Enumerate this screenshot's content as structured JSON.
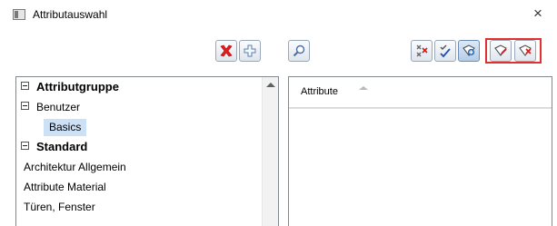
{
  "window": {
    "title": "Attributauswahl",
    "close_glyph": "×"
  },
  "toolbar": {
    "buttons": [
      {
        "name": "delete-button",
        "icon": "red-x-icon"
      },
      {
        "name": "add-button",
        "icon": "plus-icon"
      },
      {
        "name": "search-button",
        "icon": "magnifier-icon"
      },
      {
        "name": "uncheck-all-button",
        "icon": "double-x-icon"
      },
      {
        "name": "check-all-button",
        "icon": "double-check-icon"
      },
      {
        "name": "add-favorite-button",
        "icon": "pin-add-icon",
        "active": true
      },
      {
        "name": "favorite-edit-button",
        "icon": "pin-edit-icon"
      },
      {
        "name": "favorite-remove-button",
        "icon": "pin-remove-icon"
      }
    ],
    "highlight_color": "#e03030"
  },
  "tree": {
    "items": [
      {
        "label": "Attributgruppe",
        "kind": "group",
        "expanded": true
      },
      {
        "label": "Benutzer",
        "kind": "item",
        "expanded": true
      },
      {
        "label": "Basics",
        "kind": "leaf",
        "selected": true
      },
      {
        "label": "Standard",
        "kind": "group",
        "expanded": true
      },
      {
        "label": "Architektur Allgemein",
        "kind": "leaf"
      },
      {
        "label": "Attribute Material",
        "kind": "leaf"
      },
      {
        "label": "Türen, Fenster",
        "kind": "leaf"
      }
    ]
  },
  "list": {
    "column_header": "Attribute"
  },
  "colors": {
    "selection": "#cce0f6",
    "border": "#828790"
  }
}
